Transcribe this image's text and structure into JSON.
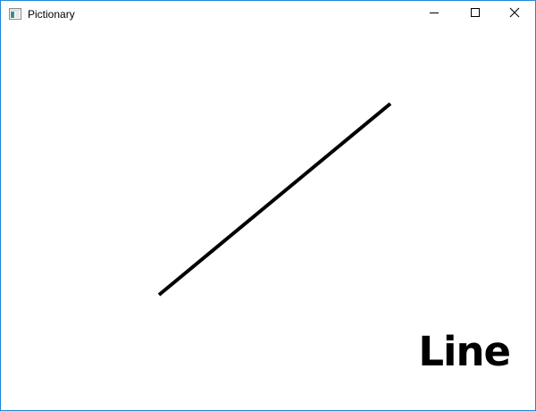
{
  "window": {
    "title": "Pictionary",
    "border_color": "#1e88d6"
  },
  "caption_buttons": {
    "minimize_icon": "minimize-icon",
    "maximize_icon": "maximize-icon",
    "close_icon": "close-icon"
  },
  "canvas": {
    "background": "#ffffff",
    "stroke_color": "#000000",
    "shape": "line"
  },
  "guess": {
    "label": "Line"
  }
}
